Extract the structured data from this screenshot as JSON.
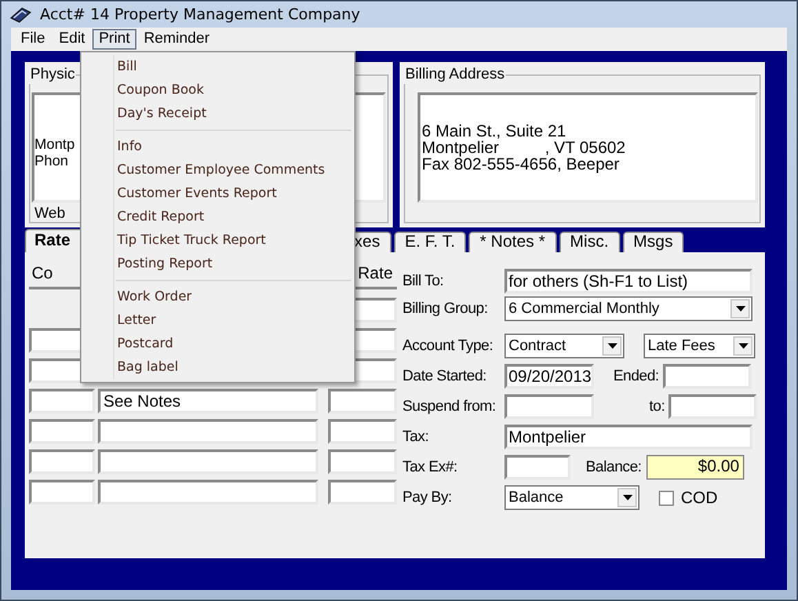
{
  "window": {
    "title": "Acct# 14 Property Management Company"
  },
  "menu_bar": [
    {
      "label": "File",
      "selected": false
    },
    {
      "label": "Edit",
      "selected": false
    },
    {
      "label": "Print",
      "selected": true
    },
    {
      "label": "Reminder",
      "selected": false
    }
  ],
  "print_menu": [
    {
      "kind": "item",
      "label": "Bill"
    },
    {
      "kind": "item",
      "label": "Coupon Book"
    },
    {
      "kind": "item",
      "label": "Day's Receipt"
    },
    {
      "kind": "separator"
    },
    {
      "kind": "item",
      "label": "Info"
    },
    {
      "kind": "item",
      "label": "Customer Employee Comments"
    },
    {
      "kind": "item",
      "label": "Customer Events Report"
    },
    {
      "kind": "item",
      "label": "Credit Report"
    },
    {
      "kind": "item",
      "label": "Tip Ticket Truck Report"
    },
    {
      "kind": "item",
      "label": "Posting Report"
    },
    {
      "kind": "separator"
    },
    {
      "kind": "item",
      "label": "Work Order"
    },
    {
      "kind": "item",
      "label": "Letter"
    },
    {
      "kind": "item",
      "label": "Postcard"
    },
    {
      "kind": "item",
      "label": "Bag label"
    }
  ],
  "physical_address": {
    "title": "Physic",
    "lines": [
      "Montp",
      "Phon"
    ],
    "web_label": "Web"
  },
  "billing_address": {
    "title": "Billing Address",
    "lines": [
      "6 Main St., Suite 21",
      "Montpelier          , VT 05602",
      "Fax 802-555-4656, Beeper"
    ]
  },
  "tabs": [
    {
      "label": "Rate",
      "selected": true
    },
    {
      "label": "xes",
      "selected": false
    },
    {
      "label": "E. F. T.",
      "selected": false
    },
    {
      "label": "* Notes *",
      "selected": false
    },
    {
      "label": "Misc.",
      "selected": false
    },
    {
      "label": "Msgs",
      "selected": false
    }
  ],
  "rates_table": {
    "columns": [
      "Co",
      "Rate"
    ],
    "rows": [
      {
        "kind": "rate_only"
      },
      {
        "kind": "code_rate"
      },
      {
        "kind": "code_rate"
      },
      {
        "kind": "full",
        "description": "See Notes"
      },
      {
        "kind": "full"
      },
      {
        "kind": "full"
      },
      {
        "kind": "full"
      }
    ]
  },
  "account_form": {
    "bill_to": {
      "label": "Bill To:",
      "value": "for others (Sh-F1 to List)"
    },
    "billing_group": {
      "label": "Billing Group:",
      "value": "6  Commercial Monthly"
    },
    "account_type": {
      "label": "Account Type:",
      "value": "Contract"
    },
    "late_fees": {
      "value": "Late Fees"
    },
    "date_started": {
      "label": "Date Started:",
      "value": "09/20/2013"
    },
    "ended": {
      "label": "Ended:"
    },
    "suspend_from": {
      "label": "Suspend from:"
    },
    "suspend_to": {
      "label": "to:"
    },
    "tax": {
      "label": "Tax:",
      "value": "Montpelier"
    },
    "tax_ex": {
      "label": "Tax Ex#:"
    },
    "balance": {
      "label": "Balance:",
      "value": "$0.00"
    },
    "pay_by": {
      "label": "Pay By:",
      "value": "Balance"
    },
    "cod": {
      "label": "COD",
      "checked": false
    }
  }
}
